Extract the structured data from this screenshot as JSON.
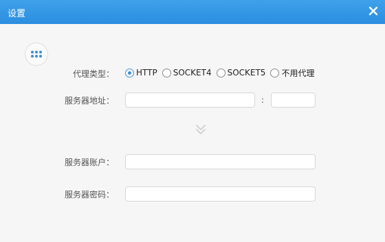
{
  "window": {
    "title": "设置",
    "close_icon": "close-icon"
  },
  "app_menu_icon": "grid-dots-icon",
  "proxy": {
    "type_label": "代理类型：",
    "options": [
      "HTTP",
      "SOCKET4",
      "SOCKET5",
      "不用代理"
    ],
    "selected": "HTTP"
  },
  "server": {
    "address_label": "服务器地址：",
    "address_value": "",
    "port_separator": ":",
    "port_value": "",
    "account_label": "服务器账户：",
    "account_value": "",
    "password_label": "服务器密码：",
    "password_value": ""
  },
  "expand_icon": "chevron-double-down-icon",
  "colors": {
    "titlebar": "#3ea1ea",
    "accent": "#3a8fd8",
    "background": "#f6f6f6"
  }
}
